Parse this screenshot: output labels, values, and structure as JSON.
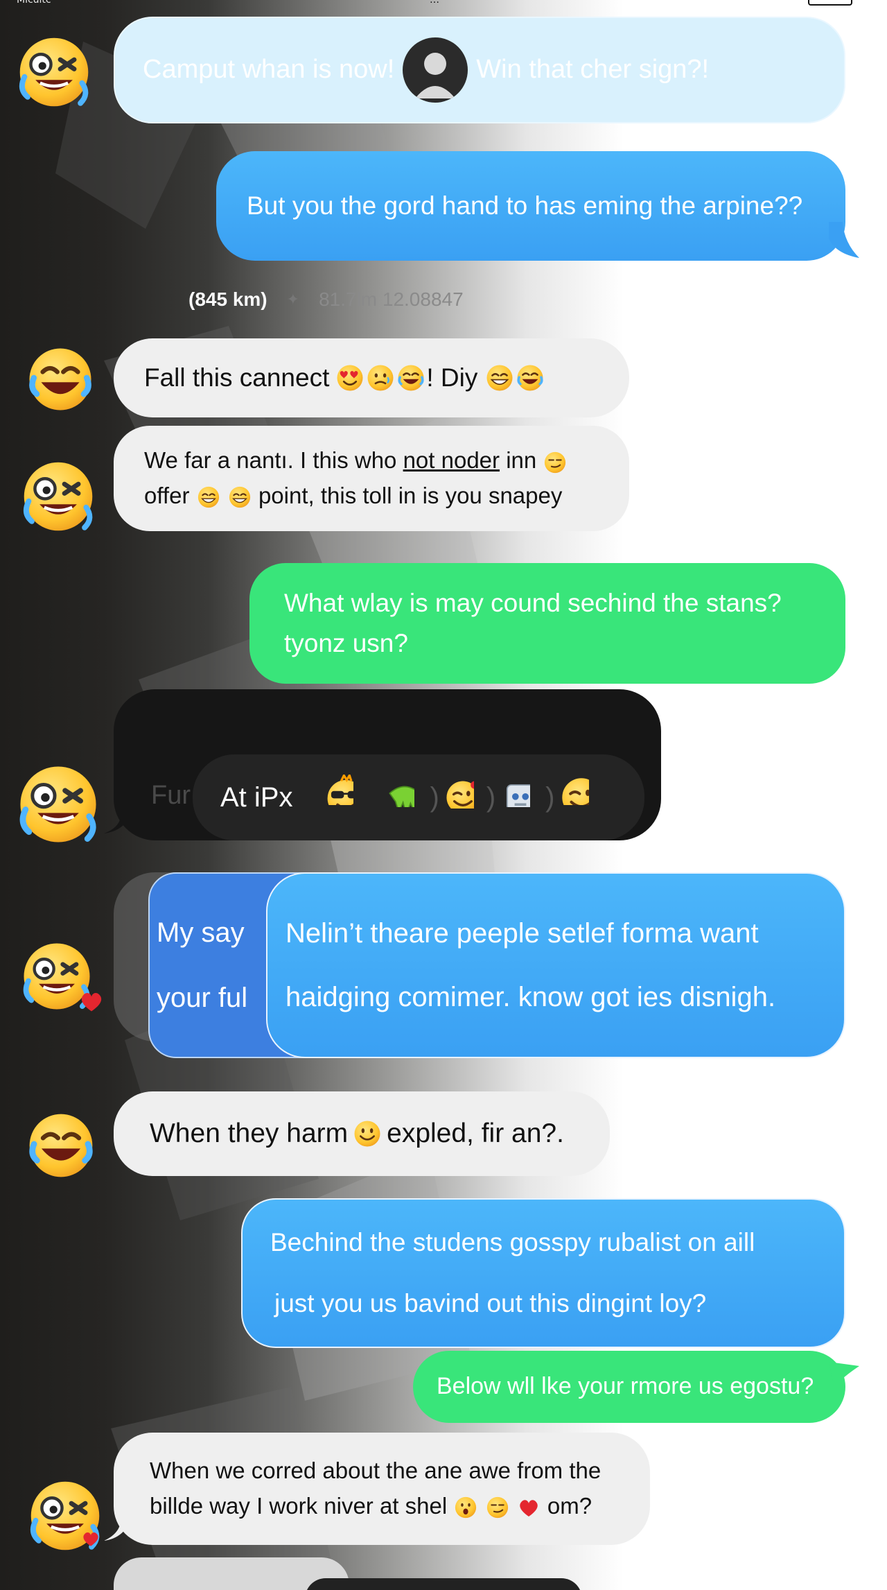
{
  "status_bar": {
    "left": "Micuitc",
    "center": "…",
    "right": ""
  },
  "colors": {
    "incoming_bubble": "#efefef",
    "outgoing_blue": "#3aa0f3",
    "outgoing_green": "#39e57a",
    "light_bubble": "#d9f1fd",
    "dark_bubble": "#1c1c1c"
  },
  "messages": [
    {
      "side": "in",
      "style": "light",
      "text_a": "Camput whan is now!",
      "text_b": "Win that cher sign?!"
    },
    {
      "side": "out",
      "style": "blue",
      "text": "But you the gord hand to has eming the arpine??"
    },
    {
      "side": "in",
      "style": "gray",
      "text": "Fall this cannect",
      "suffix": "! Diy"
    },
    {
      "side": "in",
      "style": "gray",
      "line1_a": "We far a nantı. I this who",
      "line1_b": "not noder",
      "line1_c": "inn",
      "line2_a": "offer",
      "line2_b": "point, this toll in is you snapey"
    },
    {
      "side": "out",
      "style": "green",
      "line1": "What wlay is may cound sechind the stans?",
      "line2": "tyonz usn?"
    },
    {
      "side": "in",
      "style": "dark",
      "ghost": "Fur",
      "label": "At iPx"
    },
    {
      "side": "out",
      "style": "blue-stack",
      "back_line1": "My say",
      "back_line2": "your ful",
      "line1": "Nelin’t theare peeple setlef forma want",
      "line2": "haidging comimer. know got ies disnigh."
    },
    {
      "side": "in",
      "style": "gray",
      "text_a": "When they harm",
      "text_b": "expled, fir an?."
    },
    {
      "side": "out",
      "style": "blue",
      "line1": "Bechind the studens gosspy rubalist on aill",
      "line2": "just you us bavind out this dingint loy?"
    },
    {
      "side": "out",
      "style": "green",
      "text": "Below wll lke your rmore us egostu?"
    },
    {
      "side": "in",
      "style": "gray",
      "line1": "When we corred about the ane awe from the",
      "line2": "billde way I work niver at shel",
      "line2_end": "om?"
    }
  ],
  "meta_row": {
    "distance": "(845 km)",
    "divider": "✦",
    "coords": "81.7lm 12.08847"
  },
  "icons": [
    "laughing-crying-emoji-avatar",
    "person-avatar-icon",
    "heart-eyes-emoji",
    "sunglasses-emoji",
    "slime-icon",
    "robot-icon",
    "heart-icon"
  ]
}
